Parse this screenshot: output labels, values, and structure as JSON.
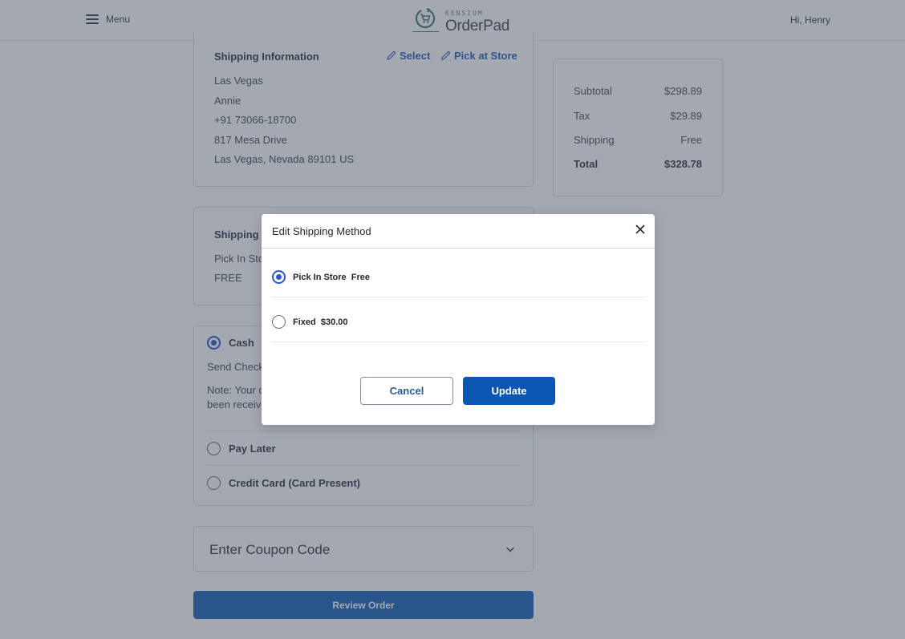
{
  "header": {
    "menu_label": "Menu",
    "brand_small": "KENSIUM",
    "brand_name": "OrderPad",
    "greeting": "Hi, Henry",
    "logo_color": "#3f7a6a"
  },
  "shipping_info": {
    "title": "Shipping Information",
    "select_label": "Select",
    "pick_at_store_label": "Pick at Store",
    "lines": [
      "Las Vegas",
      "Annie",
      "+91 73066-18700",
      "817 Mesa Drive",
      "Las Vegas, Nevada 89101 US"
    ]
  },
  "order_summary": {
    "rows": [
      {
        "label": "Subtotal",
        "value": "$298.89"
      },
      {
        "label": "Tax",
        "value": "$29.89"
      },
      {
        "label": "Shipping",
        "value": "Free"
      },
      {
        "label": "Total",
        "value": "$328.78"
      }
    ]
  },
  "shipping_method": {
    "title": "Shipping Method",
    "method": "Pick In Store",
    "cost": "FREE"
  },
  "payment": {
    "options": [
      {
        "label": "Cash",
        "selected": true
      },
      {
        "label": "Pay Later",
        "selected": false
      },
      {
        "label": "Credit Card (Card Present)",
        "selected": false
      }
    ],
    "cash_detail": "Send Check",
    "cash_note_line1": "Note: Your order will be processed once payment has",
    "cash_note_line2": "been received."
  },
  "coupon": {
    "label": "Enter Coupon Code"
  },
  "review_button": "Review Order",
  "modal": {
    "title": "Edit Shipping Method",
    "options": [
      {
        "name": "Pick In Store",
        "price": "Free",
        "selected": true
      },
      {
        "name": "Fixed",
        "price": "$30.00",
        "selected": false
      }
    ],
    "cancel_label": "Cancel",
    "update_label": "Update"
  },
  "colors": {
    "primary": "#0a56b0",
    "link": "#2a62b3",
    "radio_selected": "#2d55d0"
  }
}
